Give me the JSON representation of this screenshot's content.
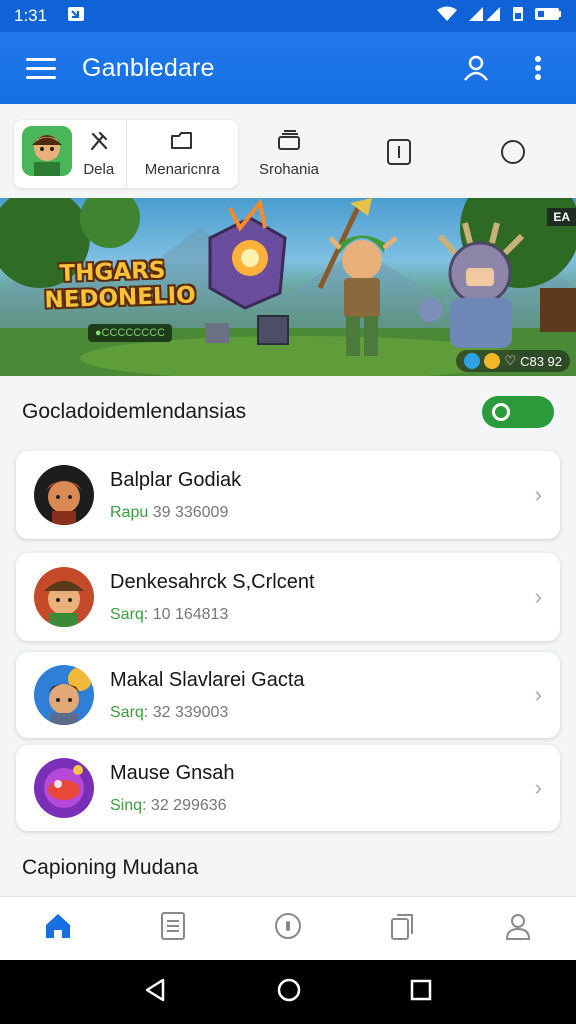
{
  "status_bar": {
    "time": "1:31"
  },
  "app_bar": {
    "title": "Ganbledare"
  },
  "tabs": [
    {
      "label": "Dela"
    },
    {
      "label": "Menaricnra"
    },
    {
      "label": "Srohania"
    },
    {
      "label": ""
    },
    {
      "label": ""
    }
  ],
  "banner": {
    "title_line1": "THGARS",
    "title_line2": "NEDONELIO",
    "subtitle": "●CCCCCCCC",
    "corner_tag": "EA",
    "stat_text": "C83 92"
  },
  "section1": {
    "title": "Gocladoidemlendansias"
  },
  "games": [
    {
      "title": "Balplar Godiak",
      "meta_tag": "Rapu",
      "meta_value": "39 336009"
    },
    {
      "title": "Denkesahrck S,Crlcent",
      "meta_tag": "Sarq:",
      "meta_value": "10 164813"
    },
    {
      "title": "Makal Slavlarei Gacta",
      "meta_tag": "Sarq:",
      "meta_value": "32 339003"
    },
    {
      "title": "Mause Gnsah",
      "meta_tag": "Sinq:",
      "meta_value": "32 299636"
    }
  ],
  "section2": {
    "title": "Capioning Mudana"
  },
  "colors": {
    "primary": "#1670e4",
    "accent_green": "#2c9b3b"
  },
  "icons": {
    "bottom_nav": [
      "home-icon",
      "document-icon",
      "compass-icon",
      "copy-icon",
      "profile-icon"
    ],
    "system_nav": [
      "back-icon",
      "home-circle-icon",
      "recents-icon"
    ]
  }
}
